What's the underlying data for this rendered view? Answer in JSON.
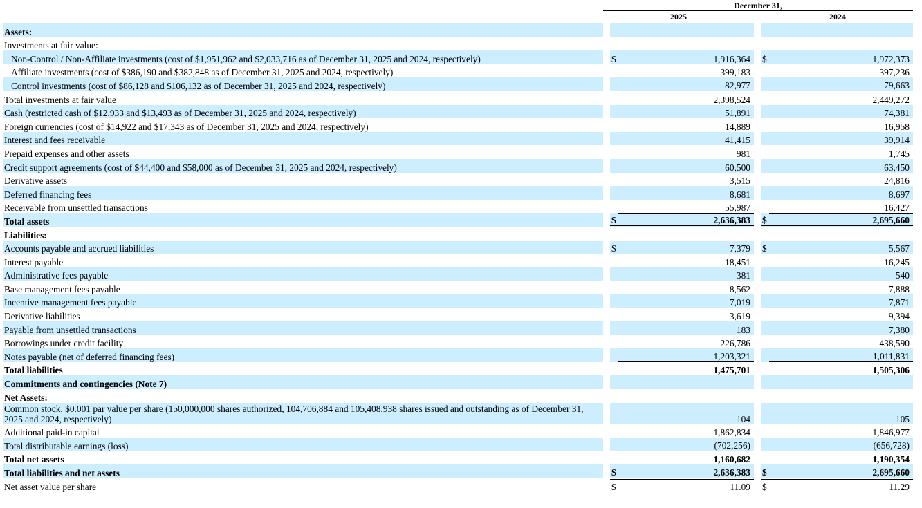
{
  "header": {
    "period_label": "December 31,",
    "col_2025": "2025",
    "col_2024": "2024",
    "currency_symbol": "$"
  },
  "rows": [
    {
      "label": "Assets:",
      "v2025": "",
      "v2024": ""
    },
    {
      "label": "Investments at fair value:",
      "v2025": "",
      "v2024": ""
    },
    {
      "label": "Non-Control / Non-Affiliate investments (cost of $1,951,962 and $2,033,716 as of December 31, 2025 and 2024, respectively)",
      "v2025": "1,916,364",
      "v2024": "1,972,373"
    },
    {
      "label": "Affiliate investments (cost of $386,190 and $382,848 as of December 31, 2025 and 2024, respectively)",
      "v2025": "399,183",
      "v2024": "397,236"
    },
    {
      "label": "Control investments (cost of $86,128 and $106,132 as of December 31, 2025 and 2024, respectively)",
      "v2025": "82,977",
      "v2024": "79,663"
    },
    {
      "label": "Total investments at fair value",
      "v2025": "2,398,524",
      "v2024": "2,449,272"
    },
    {
      "label": "Cash (restricted cash of $12,933 and $13,493 as of December 31, 2025 and 2024, respectively)",
      "v2025": "51,891",
      "v2024": "74,381"
    },
    {
      "label": "Foreign currencies (cost of $14,922 and $17,343 as of December 31, 2025 and 2024, respectively)",
      "v2025": "14,889",
      "v2024": "16,958"
    },
    {
      "label": "Interest and fees receivable",
      "v2025": "41,415",
      "v2024": "39,914"
    },
    {
      "label": "Prepaid expenses and other assets",
      "v2025": "981",
      "v2024": "1,745"
    },
    {
      "label": "Credit support agreements (cost of $44,400 and $58,000 as of December 31, 2025 and 2024, respectively)",
      "v2025": "60,500",
      "v2024": "63,450"
    },
    {
      "label": "Derivative assets",
      "v2025": "3,515",
      "v2024": "24,816"
    },
    {
      "label": "Deferred financing fees",
      "v2025": "8,681",
      "v2024": "8,697"
    },
    {
      "label": "Receivable from unsettled transactions",
      "v2025": "55,987",
      "v2024": "16,427"
    },
    {
      "label": "Total assets",
      "v2025": "2,636,383",
      "v2024": "2,695,660"
    },
    {
      "label": "Liabilities:",
      "v2025": "",
      "v2024": ""
    },
    {
      "label": "Accounts payable and accrued liabilities",
      "v2025": "7,379",
      "v2024": "5,567"
    },
    {
      "label": "Interest payable",
      "v2025": "18,451",
      "v2024": "16,245"
    },
    {
      "label": "Administrative fees payable",
      "v2025": "381",
      "v2024": "540"
    },
    {
      "label": "Base management fees payable",
      "v2025": "8,562",
      "v2024": "7,888"
    },
    {
      "label": "Incentive management fees payable",
      "v2025": "7,019",
      "v2024": "7,871"
    },
    {
      "label": "Derivative liabilities",
      "v2025": "3,619",
      "v2024": "9,394"
    },
    {
      "label": "Payable from unsettled transactions",
      "v2025": "183",
      "v2024": "7,380"
    },
    {
      "label": "Borrowings under credit facility",
      "v2025": "226,786",
      "v2024": "438,590"
    },
    {
      "label": "Notes payable (net of deferred financing fees)",
      "v2025": "1,203,321",
      "v2024": "1,011,831"
    },
    {
      "label": "Total liabilities",
      "v2025": "1,475,701",
      "v2024": "1,505,306"
    },
    {
      "label": "Commitments and contingencies (Note 7)",
      "v2025": "",
      "v2024": ""
    },
    {
      "label": "Net Assets:",
      "v2025": "",
      "v2024": ""
    },
    {
      "label": "Common stock, $0.001 par value per share (150,000,000 shares authorized, 104,706,884 and 105,408,938 shares issued and outstanding as of December 31, 2025 and 2024, respectively)",
      "v2025": "104",
      "v2024": "105"
    },
    {
      "label": "Additional paid-in capital",
      "v2025": "1,862,834",
      "v2024": "1,846,977"
    },
    {
      "label": "Total distributable earnings (loss)",
      "v2025": "(702,256)",
      "v2024": "(656,728)"
    },
    {
      "label": "Total net assets",
      "v2025": "1,160,682",
      "v2024": "1,190,354"
    },
    {
      "label": "Total liabilities and net assets",
      "v2025": "2,636,383",
      "v2024": "2,695,660"
    },
    {
      "label": "Net asset value per share",
      "v2025": "11.09",
      "v2024": "11.29"
    }
  ]
}
